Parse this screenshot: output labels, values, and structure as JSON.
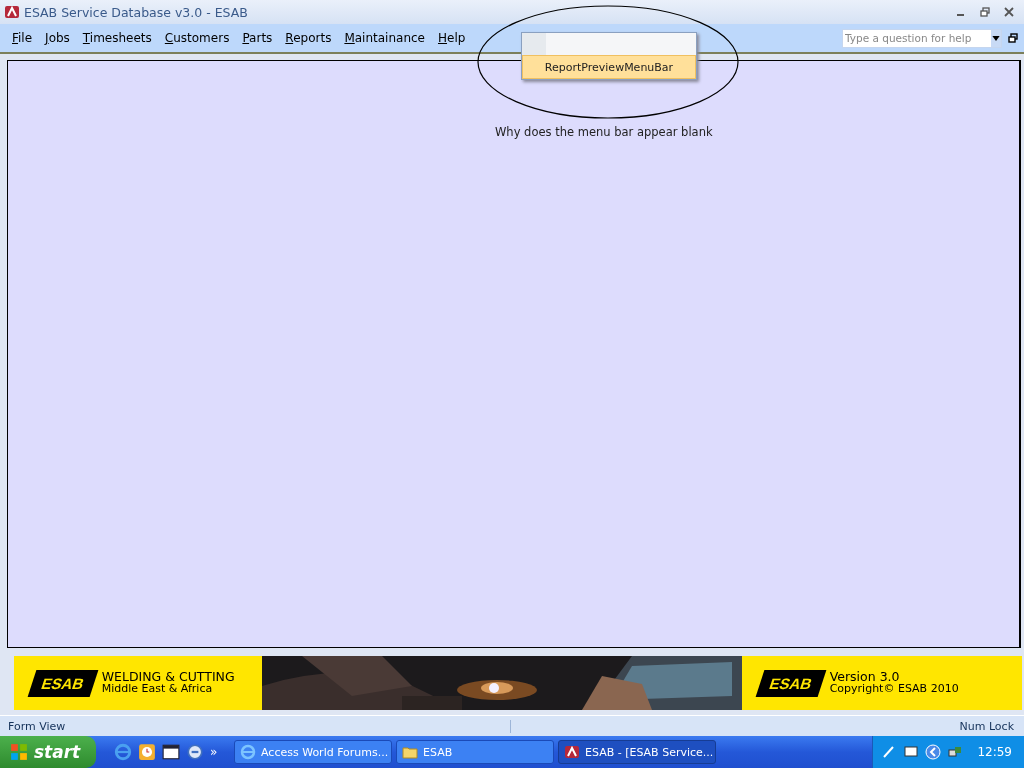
{
  "window": {
    "title": "ESAB Service Database v3.0 - ESAB"
  },
  "menu": [
    {
      "label": "File"
    },
    {
      "label": "Jobs"
    },
    {
      "label": "Timesheets"
    },
    {
      "label": "Customers"
    },
    {
      "label": "Parts"
    },
    {
      "label": "Reports"
    },
    {
      "label": "Maintainance"
    },
    {
      "label": "Help"
    }
  ],
  "help_box": {
    "placeholder": "Type a question for help"
  },
  "popup": {
    "items": [
      {
        "label": "ReportPreviewMenuBar",
        "selected": true
      }
    ]
  },
  "annotation": "Why does the menu bar appear blank",
  "banner": {
    "left_logo": "ESAB",
    "left_title": "WELDING & CUTTING",
    "left_subtitle": "Middle East & Africa",
    "right_logo": "ESAB",
    "version": "Version 3.0",
    "copyright": "Copyright© ESAB 2010"
  },
  "status_bar": {
    "left": "Form View",
    "right": "Num Lock"
  },
  "taskbar": {
    "start": "start",
    "quick_more": "»",
    "tasks": [
      {
        "label": "Access World Forums...",
        "kind": "browser",
        "selected": false
      },
      {
        "label": "ESAB",
        "kind": "folder",
        "selected": false
      },
      {
        "label": "ESAB - [ESAB Service...",
        "kind": "app",
        "selected": true
      }
    ],
    "clock": "12:59"
  }
}
